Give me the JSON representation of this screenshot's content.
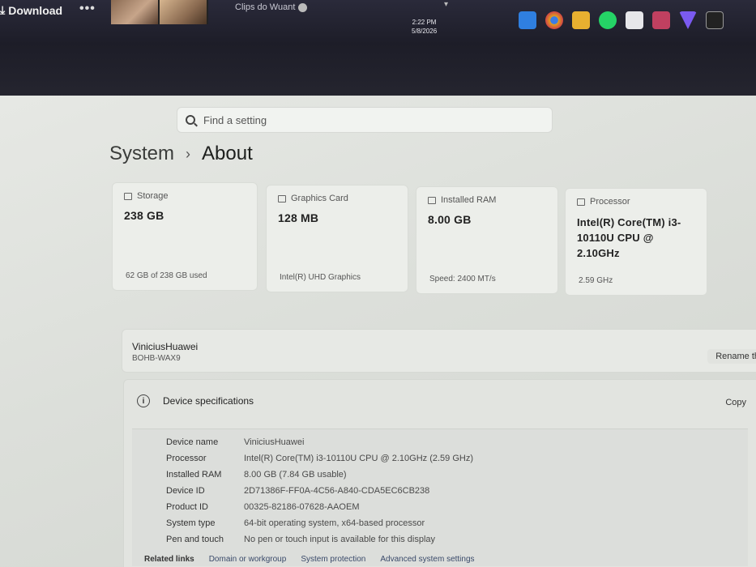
{
  "topbar": {
    "download_label": "Download",
    "more_label": "•••",
    "clips_label": "Clips do Wuant",
    "clock_time": "2:22 PM",
    "clock_date": "5/8/2026"
  },
  "colors": {
    "tray": [
      "#2f7fe0",
      "#e0a020",
      "#e8b030",
      "#25d366",
      "#d04545",
      "#c04060",
      "#7a5af0",
      "#222222"
    ]
  },
  "search": {
    "placeholder": "Find a setting"
  },
  "breadcrumb": {
    "parent": "System",
    "current": "About"
  },
  "cards": [
    {
      "title": "Storage",
      "value": "238 GB",
      "sub": "62 GB of 238 GB used"
    },
    {
      "title": "Graphics Card",
      "value": "128 MB",
      "sub": "Intel(R) UHD Graphics"
    },
    {
      "title": "Installed RAM",
      "value": "8.00 GB",
      "sub": "Speed: 2400 MT/s"
    },
    {
      "title": "Processor",
      "value": "Intel(R) Core(TM) i3-10110U CPU @ 2.10GHz",
      "sub": "2.59 GHz"
    }
  ],
  "device": {
    "name": "ViniciusHuawei",
    "model": "BOHB-WAX9",
    "rename_label": "Rename th"
  },
  "specs": {
    "title": "Device specifications",
    "copy_label": "Copy",
    "rows": [
      {
        "key": "Device name",
        "value": "ViniciusHuawei"
      },
      {
        "key": "Processor",
        "value": "Intel(R) Core(TM) i3-10110U CPU @ 2.10GHz (2.59 GHz)"
      },
      {
        "key": "Installed RAM",
        "value": "8.00 GB (7.84 GB usable)"
      },
      {
        "key": "Device ID",
        "value": "2D71386F-FF0A-4C56-A840-CDA5EC6CB238"
      },
      {
        "key": "Product ID",
        "value": "00325-82186-07628-AAOEM"
      },
      {
        "key": "System type",
        "value": "64-bit operating system, x64-based processor"
      },
      {
        "key": "Pen and touch",
        "value": "No pen or touch input is available for this display"
      }
    ]
  },
  "related": {
    "label": "Related links",
    "links": [
      "Domain or workgroup",
      "System protection",
      "Advanced system settings"
    ]
  }
}
